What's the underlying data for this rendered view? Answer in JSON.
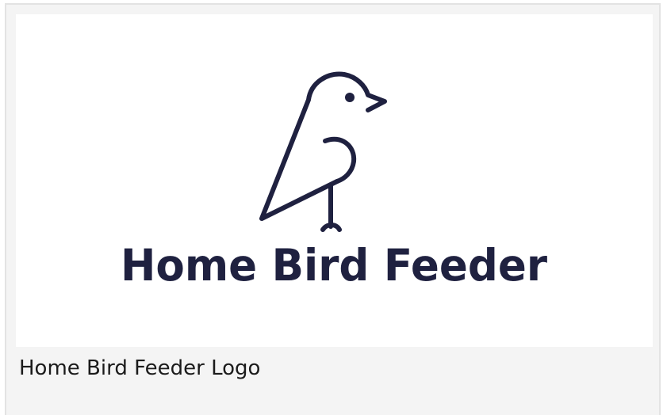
{
  "logo": {
    "wordmark": "Home Bird Feeder",
    "icon": "bird-icon",
    "color": "#1f2140"
  },
  "caption": {
    "text": "Home Bird Feeder Logo"
  },
  "colors": {
    "card_background": "#f4f4f4",
    "card_border": "#e3e3e3",
    "image_background": "#ffffff",
    "caption_text": "#1b1b1b"
  }
}
